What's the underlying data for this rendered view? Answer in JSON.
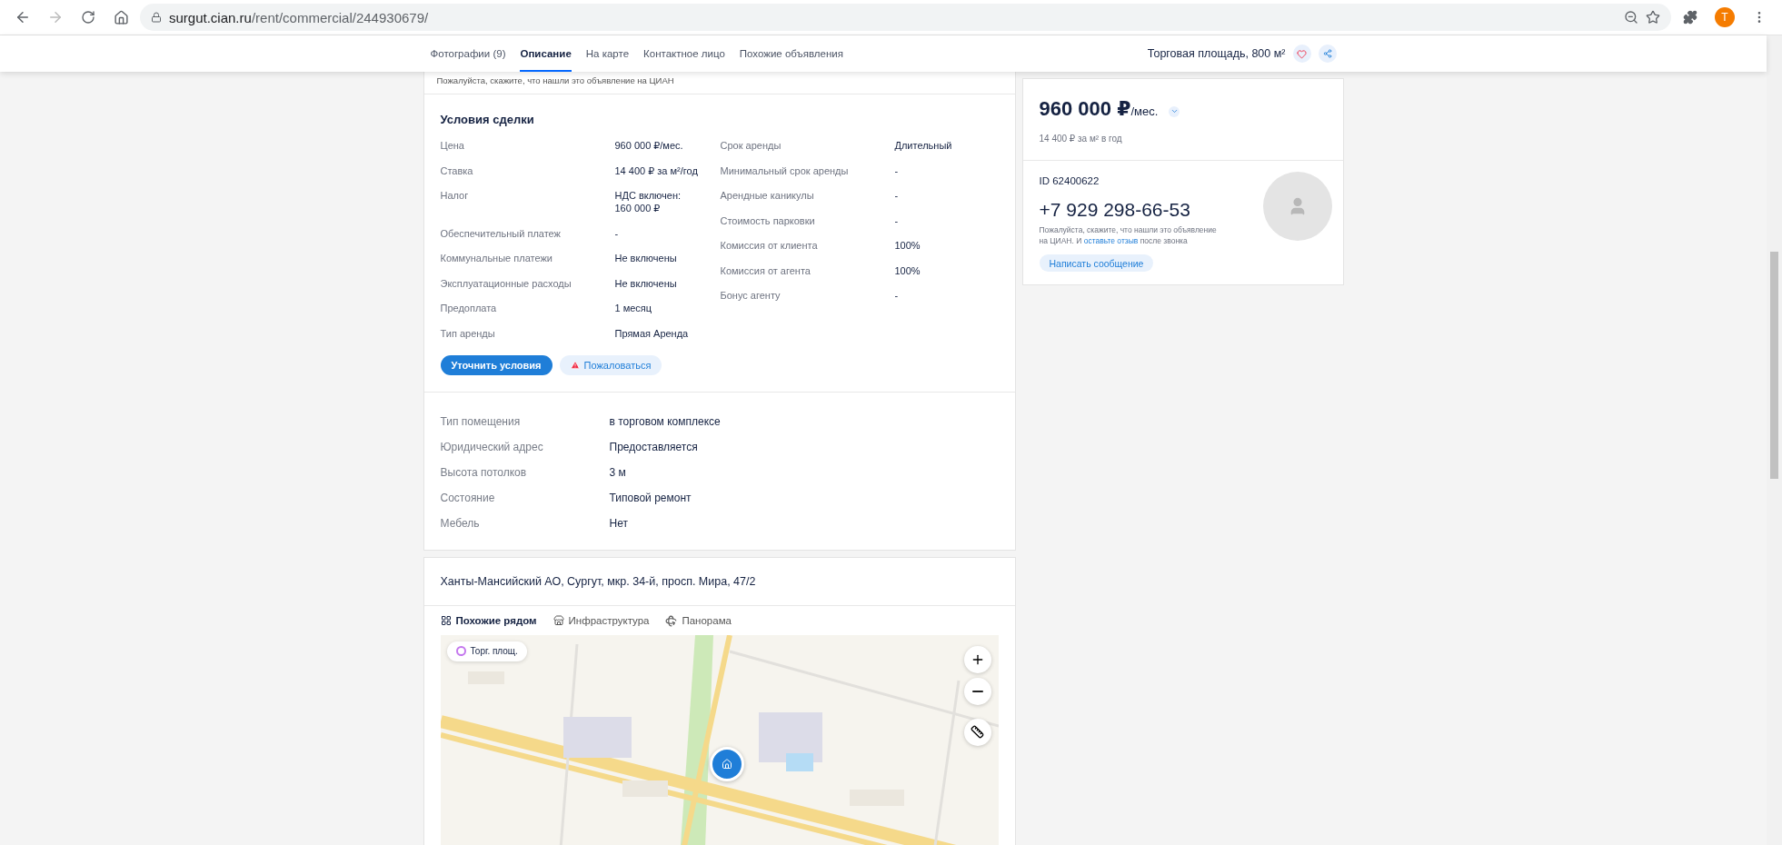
{
  "browser": {
    "url_host": "surgut.cian.ru",
    "url_path": "/rent/commercial/244930679/",
    "profile_initial": "T"
  },
  "nav": {
    "tabs": [
      {
        "label": "Фотографии (9)",
        "selected": false
      },
      {
        "label": "Описание",
        "selected": true
      },
      {
        "label": "На карте",
        "selected": false
      },
      {
        "label": "Контактное лицо",
        "selected": false
      },
      {
        "label": "Похожие объявления",
        "selected": false
      }
    ],
    "title": "Торговая площадь, 800 м²"
  },
  "feedback_note": "Пожалуйста, скажите, что нашли это объявление на ЦИАН",
  "deal": {
    "title": "Условия сделки",
    "left": [
      {
        "label": "Цена",
        "value": "960 000 ₽/мес."
      },
      {
        "label": "Ставка",
        "value": "14 400 ₽ за м²/год"
      },
      {
        "label": "Налог",
        "value": "НДС включен:\n160 000 ₽"
      },
      {
        "label": "Обеспечительный платеж",
        "value": "-"
      },
      {
        "label": "Коммунальные платежи",
        "value": "Не включены"
      },
      {
        "label": "Эксплуатационные расходы",
        "value": "Не включены"
      },
      {
        "label": "Предоплата",
        "value": "1 месяц"
      },
      {
        "label": "Тип аренды",
        "value": "Прямая Аренда"
      }
    ],
    "right": [
      {
        "label": "Срок аренды",
        "value": "Длительный"
      },
      {
        "label": "Минимальный срок аренды",
        "value": "-"
      },
      {
        "label": "Арендные каникулы",
        "value": "-"
      },
      {
        "label": "Стоимость парковки",
        "value": "-"
      },
      {
        "label": "Комиссия от клиента",
        "value": "100%"
      },
      {
        "label": "Комиссия от агента",
        "value": "100%"
      },
      {
        "label": "Бонус агенту",
        "value": "-"
      }
    ],
    "buttons": [
      {
        "label": "Уточнить условия",
        "kind": "primary"
      },
      {
        "label": "Пожаловаться",
        "kind": "complaint"
      }
    ]
  },
  "features": [
    {
      "label": "Тип помещения",
      "value": "в торговом комплексе"
    },
    {
      "label": "Юридический адрес",
      "value": "Предоставляется"
    },
    {
      "label": "Высота потолков",
      "value": "3 м"
    },
    {
      "label": "Состояние",
      "value": "Типовой ремонт"
    },
    {
      "label": "Мебель",
      "value": "Нет"
    }
  ],
  "location": {
    "address": "Ханты-Мансийский АО, Сургут, мкр. 34-й, просп. Мира, 47/2",
    "tabs": [
      {
        "label": "Похожие рядом",
        "selected": true,
        "kind": "grid"
      },
      {
        "label": "Инфраструктура",
        "selected": false,
        "kind": "infra"
      },
      {
        "label": "Панорама",
        "selected": false,
        "kind": "panorama"
      }
    ],
    "map": {
      "filter_chip": "Торг. площ."
    }
  },
  "sidebar": {
    "price": "960 000 ₽",
    "price_unit": "/мес.",
    "rate": "14 400 ₽ за м² в год",
    "agent_id": "ID 62400622",
    "phone": "+7 929 298-66-53",
    "note_before": "Пожалуйста, скажите, что нашли это объявление на ЦИАН. И",
    "note_link": "оставьте отзыв",
    "note_after": "после звонка",
    "message_button": "Написать сообщение"
  }
}
